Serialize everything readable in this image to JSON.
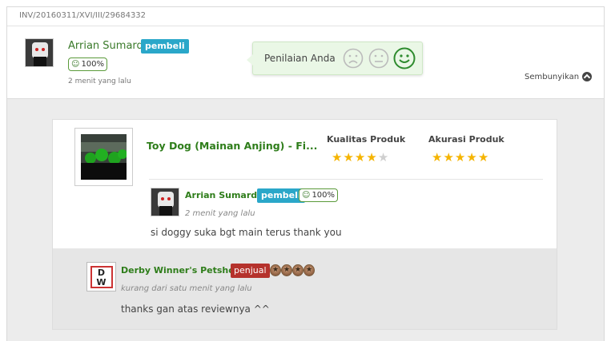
{
  "invoice": {
    "number": "INV/20160311/XVI/III/29684332"
  },
  "buyer": {
    "name": "Arrian Sumardi",
    "role_badge": "pembeli",
    "reputation": "100%",
    "time": "2 menit yang lalu"
  },
  "rating_prompt": {
    "label": "Penilaian Anda",
    "faces": [
      "sad-face-icon",
      "neutral-face-icon",
      "happy-face-icon"
    ],
    "selected": "happy-face-icon"
  },
  "hide_link": {
    "label": "Sembunyikan"
  },
  "product": {
    "title": "Toy Dog (Mainan Anjing) - Fi...",
    "quality_label": "Kualitas Produk",
    "quality_stars": 4,
    "accuracy_label": "Akurasi Produk",
    "accuracy_stars": 5,
    "max_stars": 5
  },
  "review": {
    "reviewer_name": "Arrian Sumardi",
    "role_badge": "pembeli",
    "reputation": "100%",
    "time": "2 menit yang lalu",
    "text": "si doggy suka bgt main terus thank you"
  },
  "reply": {
    "seller_name": "Derby Winner's Petshop",
    "role_badge": "penjual",
    "logo_text": "DW",
    "medal_count": 4,
    "time": "kurang dari satu menit yang lalu",
    "text": "thanks gan atas reviewnya ^^"
  },
  "colors": {
    "green_name": "#2e7d1a",
    "buyer_badge": "#2aa7c9",
    "seller_badge": "#b5322c",
    "star_on": "#f5b400",
    "star_off": "#cfcfcf",
    "rating_bg": "#eaf7e6"
  }
}
